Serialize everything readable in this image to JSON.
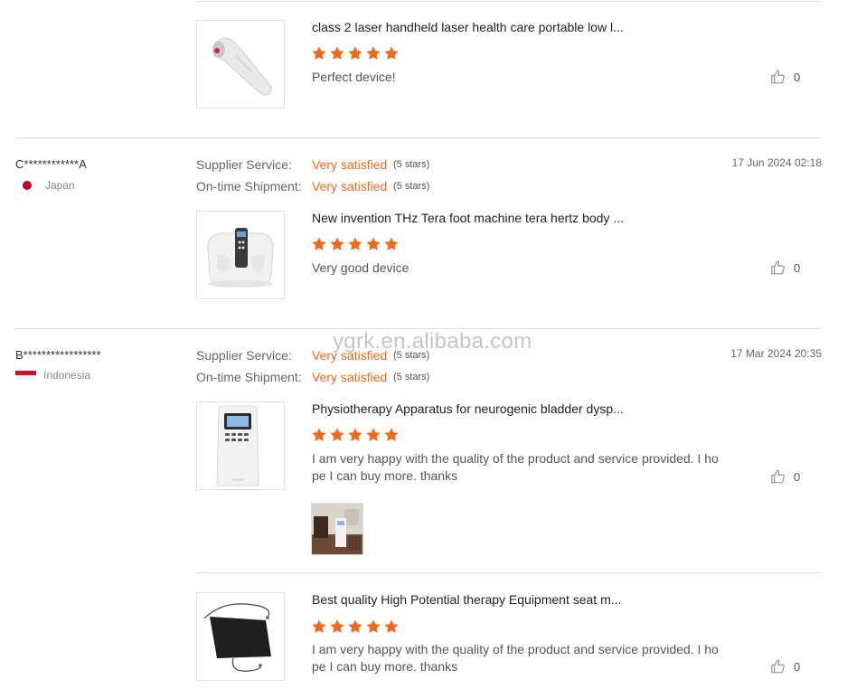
{
  "watermark": "ygrk.en.alibaba.com",
  "reviews": [
    {
      "product": {
        "title": "class 2 laser handheld laser health care portable low l...",
        "comment": "Perfect device!",
        "likes": "0",
        "rating": 5
      }
    },
    {
      "reviewer": "C************A",
      "country": "Japan",
      "supplier_label": "Supplier Service:",
      "supplier_value": "Very satisfied",
      "supplier_stars": "(5 stars)",
      "shipment_label": "On-time Shipment:",
      "shipment_value": "Very satisfied",
      "shipment_stars": "(5 stars)",
      "date": "17 Jun 2024 02:18",
      "product": {
        "title": "New invention THz Tera foot machine tera hertz body ...",
        "comment": "Very good device",
        "likes": "0",
        "rating": 5
      }
    },
    {
      "reviewer": "B*****************",
      "country": "Indonesia",
      "supplier_label": "Supplier Service:",
      "supplier_value": "Very satisfied",
      "supplier_stars": "(5 stars)",
      "shipment_label": "On-time Shipment:",
      "shipment_value": "Very satisfied",
      "shipment_stars": "(5 stars)",
      "date": "17 Mar 2024 20:35",
      "products": [
        {
          "title": "Physiotherapy Apparatus for neurogenic bladder dysp...",
          "comment_line1": "I am very happy with the quality of the product and service provided.  I ho",
          "comment_line2": "pe I can buy more.  thanks",
          "likes": "0",
          "rating": 5
        },
        {
          "title": "Best quality High Potential therapy Equipment seat m...",
          "comment_line1": "I am very happy with the quality of the product and service provided.  I ho",
          "comment_line2": "pe I can buy more.  thanks",
          "likes": "0",
          "rating": 5
        }
      ]
    }
  ],
  "colors": {
    "accent": "#f06a1c",
    "star": "#f06a1c",
    "divider": "#e0e0e0",
    "japan_flag": "#bc002d",
    "indonesia_flag": "#ce1126"
  }
}
